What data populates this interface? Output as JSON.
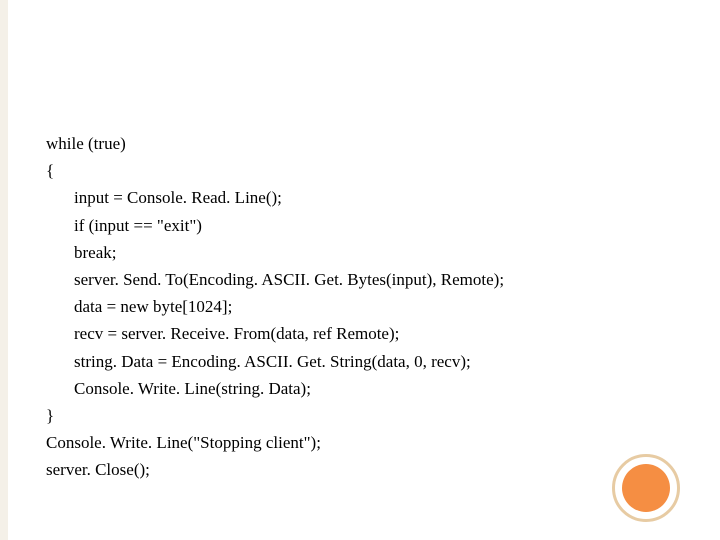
{
  "code": {
    "line1": "while (true)",
    "line2": "{",
    "line3": "input = Console. Read. Line();",
    "line4": "if (input == \"exit\")",
    "line5": "break;",
    "line6": "server. Send. To(Encoding. ASCII. Get. Bytes(input), Remote);",
    "line7": "data = new byte[1024];",
    "line8": "recv = server. Receive. From(data, ref Remote);",
    "line9": "string. Data = Encoding. ASCII. Get. String(data, 0, recv);",
    "line10": "Console. Write. Line(string. Data);",
    "line11": "}",
    "line12": "Console. Write. Line(\"Stopping client\");",
    "line13": "server. Close();"
  },
  "colors": {
    "accent": "#f58e43",
    "ring": "#e7cba3"
  }
}
